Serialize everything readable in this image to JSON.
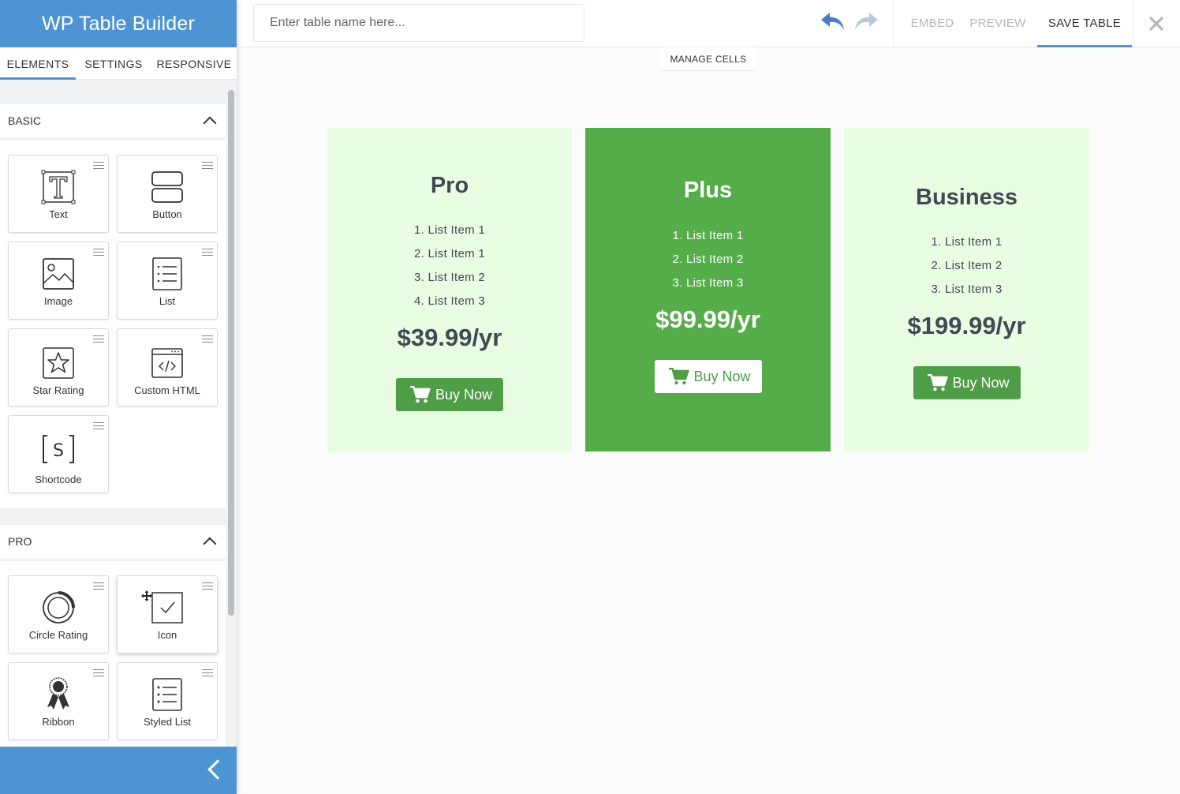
{
  "app": {
    "title": "WP Table Builder"
  },
  "sidebar": {
    "tabs": [
      {
        "label": "ELEMENTS",
        "active": true
      },
      {
        "label": "SETTINGS",
        "active": false
      },
      {
        "label": "RESPONSIVE",
        "active": false
      }
    ],
    "sections": {
      "basic": {
        "label": "BASIC",
        "items": [
          {
            "label": "Text",
            "icon": "text-icon"
          },
          {
            "label": "Button",
            "icon": "button-icon"
          },
          {
            "label": "Image",
            "icon": "image-icon"
          },
          {
            "label": "List",
            "icon": "list-icon"
          },
          {
            "label": "Star Rating",
            "icon": "star-rating-icon"
          },
          {
            "label": "Custom HTML",
            "icon": "custom-html-icon"
          },
          {
            "label": "Shortcode",
            "icon": "shortcode-icon"
          }
        ]
      },
      "pro": {
        "label": "PRO",
        "items": [
          {
            "label": "Circle Rating",
            "icon": "circle-rating-icon"
          },
          {
            "label": "Icon",
            "icon": "icon-element-icon"
          },
          {
            "label": "Ribbon",
            "icon": "ribbon-icon"
          },
          {
            "label": "Styled List",
            "icon": "styled-list-icon"
          }
        ]
      }
    }
  },
  "topbar": {
    "table_name_placeholder": "Enter table name here...",
    "table_name_value": "",
    "embed_label": "EMBED",
    "preview_label": "PREVIEW",
    "save_label": "SAVE TABLE",
    "manage_cells_label": "MANAGE CELLS"
  },
  "pricing": [
    {
      "title": "Pro",
      "items": [
        "1. List Item 1",
        "2. List Item 1",
        "3. List Item 2",
        "4. List Item 3"
      ],
      "price": "$39.99/yr",
      "button": "Buy Now"
    },
    {
      "title": "Plus",
      "items": [
        "1. List Item 1",
        "2. List Item 2",
        "3. List Item 3"
      ],
      "price": "$99.99/yr",
      "button": "Buy Now"
    },
    {
      "title": "Business",
      "items": [
        "1. List Item 1",
        "2. List Item 2",
        "3. List Item 3"
      ],
      "price": "$199.99/yr",
      "button": "Buy Now"
    }
  ],
  "colors": {
    "brand": "#4e94d3",
    "card_light": "#e9fde3",
    "card_featured": "#55ad4a",
    "button_green": "#4f9d46"
  }
}
